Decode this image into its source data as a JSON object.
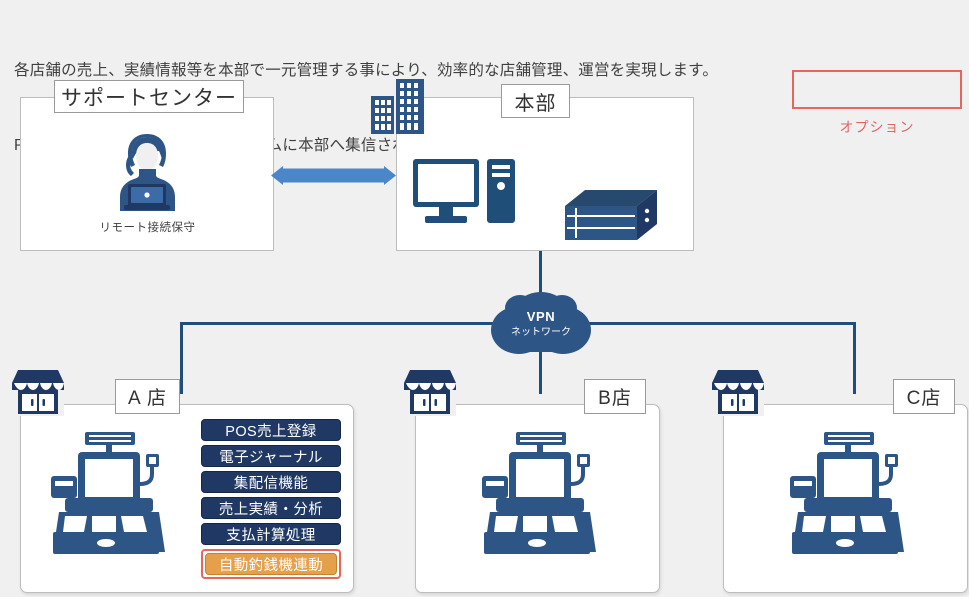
{
  "intro": {
    "line1": "各店舗の売上、実績情報等を本部で一元管理する事により、効率的な店舗管理、運営を実現します。",
    "line2": "POSレジの売上情報は、リアルタイムに本部へ集信され、本部では即時閲覧可能となります。"
  },
  "support_center": {
    "title": "サポートセンター",
    "caption": "リモート接続保守",
    "icon": "operator-woman-laptop-icon"
  },
  "headquarters": {
    "title": "本部",
    "icons": [
      "office-buildings-icon",
      "desktop-computer-icon",
      "server-nas-icon"
    ]
  },
  "network": {
    "line1": "VPN",
    "line2": "ネットワーク",
    "icon": "cloud-icon"
  },
  "stores": [
    {
      "title": "A 店",
      "icons": [
        "storefront-icon",
        "pos-register-icon"
      ],
      "features": [
        {
          "label": "POS売上登録",
          "option": false
        },
        {
          "label": "電子ジャーナル",
          "option": false
        },
        {
          "label": "集配信機能",
          "option": false
        },
        {
          "label": "売上実績・分析",
          "option": false
        },
        {
          "label": "支払計算処理",
          "option": false
        },
        {
          "label": "自動釣銭機連動",
          "option": true
        }
      ]
    },
    {
      "title": "B店",
      "icons": [
        "storefront-icon",
        "pos-register-icon"
      ],
      "features": []
    },
    {
      "title": "C店",
      "icons": [
        "storefront-icon",
        "pos-register-icon"
      ],
      "features": []
    }
  ],
  "legend": {
    "label": "オプション"
  },
  "colors": {
    "background": "#f0f0f0",
    "navy": "#1f3864",
    "line_blue": "#1f4e79",
    "icon_blue": "#2d5686",
    "arrow_blue": "#4a86c8",
    "option_orange": "#e6a04b",
    "option_red": "#e8645c",
    "panel_border": "#bdbdbd"
  }
}
